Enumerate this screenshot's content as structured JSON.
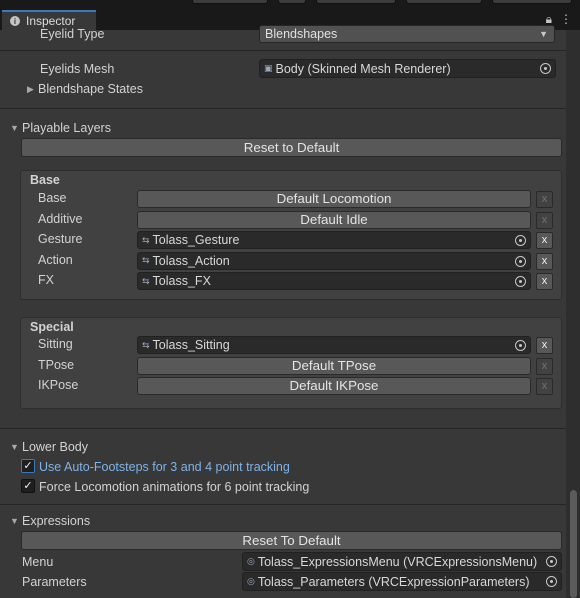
{
  "window": {
    "tab_label": "Inspector",
    "tab_icon": "info-icon",
    "lock_icon": "lock-icon",
    "menu_icon": "kebab-menu-icon",
    "accent_color": "#3a79bb"
  },
  "eyelids": {
    "eyelid_type_label": "Eyelid Type",
    "eyelid_type_value": "Blendshapes",
    "eyelids_mesh_label": "Eyelids Mesh",
    "eyelids_mesh_value": "Body (Skinned Mesh Renderer)",
    "blendshape_states_label": "Blendshape States"
  },
  "playable_layers": {
    "title": "Playable Layers",
    "reset_label": "Reset to Default",
    "base": {
      "title": "Base",
      "rows": [
        {
          "label": "Base",
          "value": "Default Locomotion",
          "kind": "default"
        },
        {
          "label": "Additive",
          "value": "Default Idle",
          "kind": "default"
        },
        {
          "label": "Gesture",
          "value": "Tolass_Gesture",
          "kind": "asset"
        },
        {
          "label": "Action",
          "value": "Tolass_Action",
          "kind": "asset"
        },
        {
          "label": "FX",
          "value": "Tolass_FX",
          "kind": "asset"
        }
      ]
    },
    "special": {
      "title": "Special",
      "rows": [
        {
          "label": "Sitting",
          "value": "Tolass_Sitting",
          "kind": "asset"
        },
        {
          "label": "TPose",
          "value": "Default TPose",
          "kind": "default"
        },
        {
          "label": "IKPose",
          "value": "Default IKPose",
          "kind": "default"
        }
      ]
    },
    "remove_glyph": "x"
  },
  "lower_body": {
    "title": "Lower Body",
    "options": [
      {
        "label": "Use Auto-Footsteps for 3 and 4 point tracking",
        "checked": true
      },
      {
        "label": "Force Locomotion animations for 6 point tracking",
        "checked": true
      }
    ],
    "check_glyph": "✓"
  },
  "expressions": {
    "title": "Expressions",
    "reset_label": "Reset To Default",
    "menu_label": "Menu",
    "menu_value": "Tolass_ExpressionsMenu (VRCExpressionsMenu)",
    "parameters_label": "Parameters",
    "parameters_value": "Tolass_Parameters (VRCExpressionParameters)"
  }
}
